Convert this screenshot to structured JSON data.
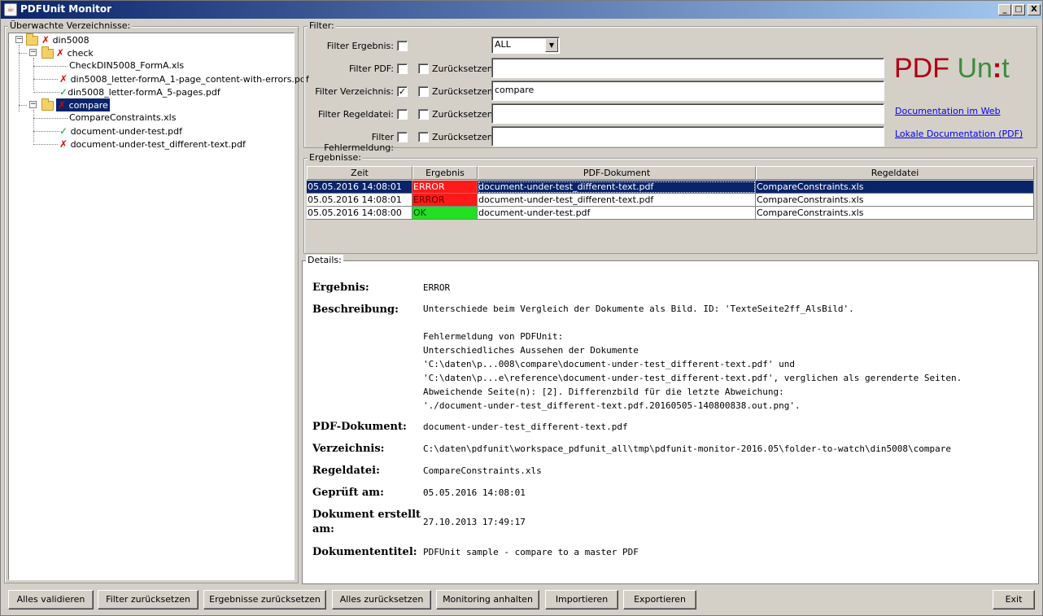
{
  "window": {
    "title": "PDFUnit Monitor",
    "min_label": "_",
    "max_label": "□",
    "close_label": "X"
  },
  "tree_panel": {
    "label": "Überwachte Verzeichnisse:",
    "items": [
      {
        "label": "din5008",
        "status": "error",
        "kind": "folder"
      },
      {
        "label": "check",
        "status": "error",
        "kind": "folder"
      },
      {
        "label": "CheckDIN5008_FormA.xls",
        "status": "none",
        "kind": "file"
      },
      {
        "label": "din5008_letter-formA_1-page_content-with-errors.pdf",
        "status": "error",
        "kind": "file"
      },
      {
        "label": "din5008_letter-formA_5-pages.pdf",
        "status": "ok",
        "kind": "file"
      },
      {
        "label": "compare",
        "status": "error",
        "kind": "folder"
      },
      {
        "label": "CompareConstraints.xls",
        "status": "none",
        "kind": "file"
      },
      {
        "label": "document-under-test.pdf",
        "status": "ok",
        "kind": "file"
      },
      {
        "label": "document-under-test_different-text.pdf",
        "status": "error",
        "kind": "file"
      }
    ]
  },
  "filter": {
    "label": "Filter:",
    "ergebnis_label": "Filter Ergebnis:",
    "ergebnis_checked": false,
    "ergebnis_value": "ALL",
    "pdf_label": "Filter PDF:",
    "pdf_checked": false,
    "pdf_value": "",
    "verzeichnis_label": "Filter Verzeichnis:",
    "verzeichnis_checked": true,
    "verzeichnis_value": "compare",
    "regeldatei_label": "Filter Regeldatei:",
    "regeldatei_checked": false,
    "regeldatei_value": "",
    "fehlermeldung_label": "Filter Fehlermeldung:",
    "fehlermeldung_checked": false,
    "fehlermeldung_value": "",
    "reset_label": "Zurücksetzen",
    "logo_pdf": "PDF",
    "logo_unit_a": "Un",
    "logo_unit_b": ":",
    "logo_unit_c": "t",
    "link_web": "Documentation im Web",
    "link_pdf": "Lokale Documentation (PDF)"
  },
  "results": {
    "label": "Ergebnisse:",
    "columns": [
      "Zeit",
      "Ergebnis",
      "PDF-Dokument",
      "Regeldatei"
    ],
    "rows": [
      {
        "zeit": "05.05.2016 14:08:01",
        "ergebnis": "ERROR",
        "dokument": "document-under-test_different-text.pdf",
        "regeldatei": "CompareConstraints.xls",
        "selected": true
      },
      {
        "zeit": "05.05.2016 14:08:01",
        "ergebnis": "ERROR",
        "dokument": "document-under-test_different-text.pdf",
        "regeldatei": "CompareConstraints.xls",
        "selected": false
      },
      {
        "zeit": "05.05.2016 14:08:00",
        "ergebnis": "OK",
        "dokument": "document-under-test.pdf",
        "regeldatei": "CompareConstraints.xls",
        "selected": false
      }
    ]
  },
  "details": {
    "label": "Details:",
    "ergebnis_label": "Ergebnis:",
    "ergebnis_value": "ERROR",
    "beschreibung_label": "Beschreibung:",
    "beschreibung_value": "Unterschiede beim Vergleich der Dokumente als Bild. ID: 'TexteSeite2ff_AlsBild'.\n\nFehlermeldung von PDFUnit:\nUnterschiedliches Aussehen der Dokumente\n'C:\\daten\\p...008\\compare\\document-under-test_different-text.pdf' und\n'C:\\daten\\p...e\\reference\\document-under-test_different-text.pdf', verglichen als gerenderte Seiten.\nAbweichende Seite(n): [2]. Differenzbild für die letzte Abweichung:\n'./document-under-test_different-text.pdf.20160505-140800838.out.png'.",
    "dokument_label": "PDF-Dokument:",
    "dokument_value": "document-under-test_different-text.pdf",
    "verzeichnis_label": "Verzeichnis:",
    "verzeichnis_value": "C:\\daten\\pdfunit\\workspace_pdfunit_all\\tmp\\pdfunit-monitor-2016.05\\folder-to-watch\\din5008\\compare",
    "regeldatei_label": "Regeldatei:",
    "regeldatei_value": "CompareConstraints.xls",
    "geprueft_label": "Geprüft am:",
    "geprueft_value": "05.05.2016 14:08:01",
    "erstellt_label_1": "Dokument erstellt",
    "erstellt_label_2": "am:",
    "erstellt_value": "27.10.2013 17:49:17",
    "titel_label": "Dokumententitel:",
    "titel_value": "PDFUnit sample - compare to a master PDF"
  },
  "buttons": {
    "validate": "Alles validieren",
    "reset_filter": "Filter zurücksetzen",
    "reset_results": "Ergebnisse zurücksetzen",
    "reset_all": "Alles zurücksetzen",
    "stop_monitoring": "Monitoring anhalten",
    "import": "Importieren",
    "export": "Exportieren",
    "exit": "Exit"
  },
  "colors": {
    "error_bg": "#ff1a1a",
    "ok_bg": "#22e022",
    "selection": "#0a246a",
    "logo_red": "#b00010",
    "logo_green": "#3c8c3c"
  }
}
